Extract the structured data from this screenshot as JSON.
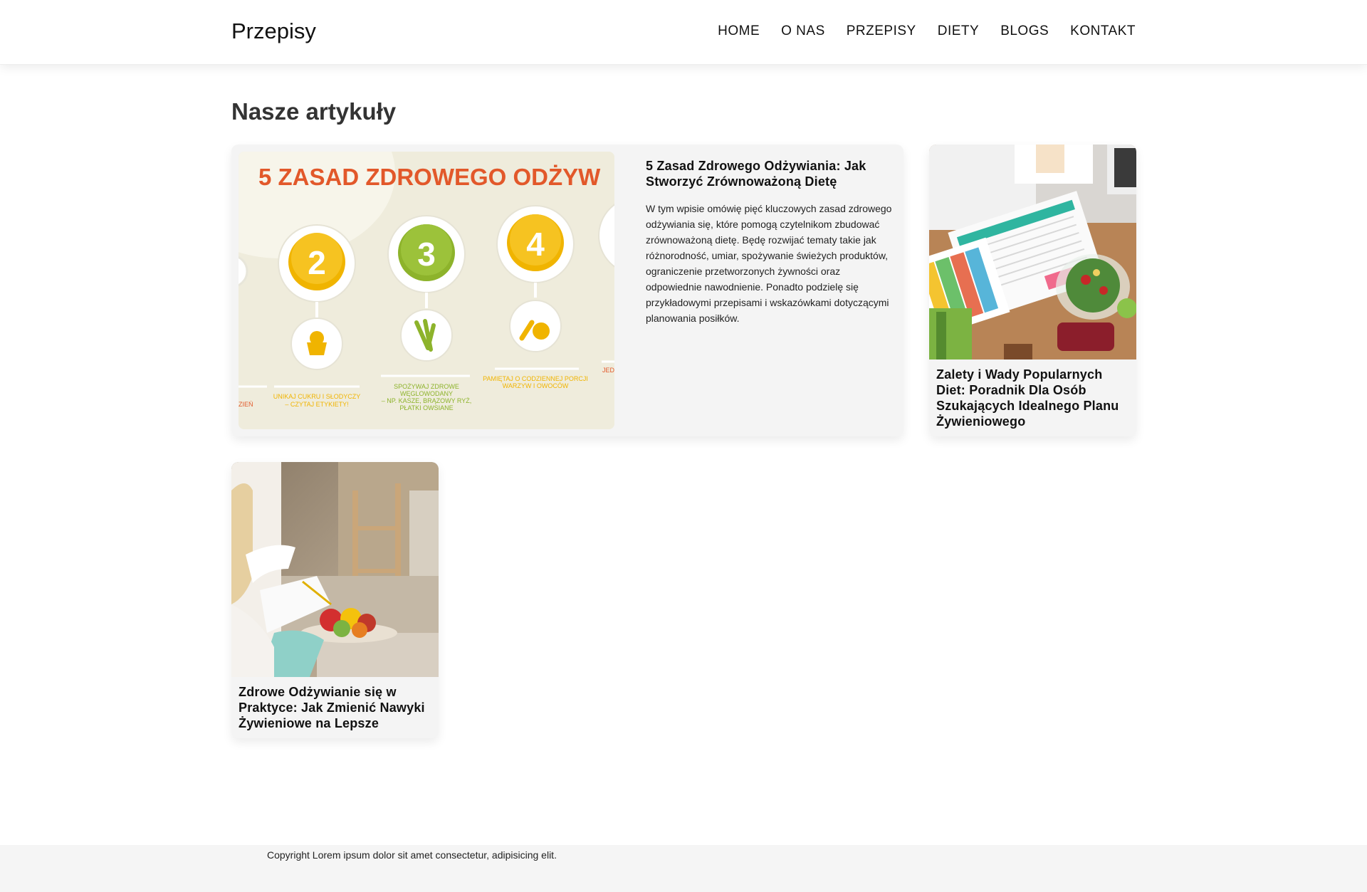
{
  "header": {
    "brand": "Przepisy",
    "nav": [
      "HOME",
      "O NAS",
      "PRZEPISY",
      "DIETY",
      "BLOGS",
      "KONTAKT"
    ]
  },
  "main": {
    "section_title": "Nasze artykuły",
    "featured": {
      "title": "5 Zasad Zdrowego Odżywiania: Jak Stworzyć Zrównoważoną Dietę",
      "excerpt": "W tym wpisie omówię pięć kluczowych zasad zdrowego odżywiania się, które pomogą czytelnikom zbudować zrównoważoną dietę. Będę rozwijać tematy takie jak różnorodność, umiar, spożywanie świeżych produktów, ograniczenie przetworzonych żywności oraz odpowiednie nawodnienie. Ponadto podzielę się przykładowymi przepisami i wskazówkami dotyczącymi planowania posiłków.",
      "image": {
        "heading": "5 ZASAD ZDROWEGO ODŻYW",
        "numbers": [
          "2",
          "3",
          "4"
        ],
        "caption_left": "ZIEŃ",
        "caption_2": [
          "UNIKAJ CUKRU I SŁODYCZY",
          "– CZYTAJ ETYKIETY!"
        ],
        "caption_3": [
          "SPOŻYWAJ ZDROWE",
          "WĘGLOWODANY",
          "– NP. KASZE, BRĄZOWY RYŻ,",
          "PŁATKI OWSIANE"
        ],
        "caption_4": [
          "PAMIĘTAJ O CODZIENNEJ PORCJI",
          "WARZYW I OWOCÓW"
        ],
        "caption_right": "JEDZ",
        "colors": {
          "orange": "#e2582a",
          "yellow": "#f0b400",
          "green": "#8db32b",
          "bg": "#efecdc"
        }
      }
    },
    "cards": [
      {
        "title": "Zalety i Wady Popularnych Diet: Poradnik Dla Osób Szukających Idealnego Planu Żywieniowego",
        "image_icon": "meal-plan-photo"
      },
      {
        "title": "Zdrowe Odżywianie się w Praktyce: Jak Zmienić Nawyki Żywieniowe na Lepsze",
        "image_icon": "dietitian-photo"
      }
    ]
  },
  "footer": {
    "copyright": "Copyright Lorem ipsum dolor sit amet consectetur, adipisicing elit."
  }
}
